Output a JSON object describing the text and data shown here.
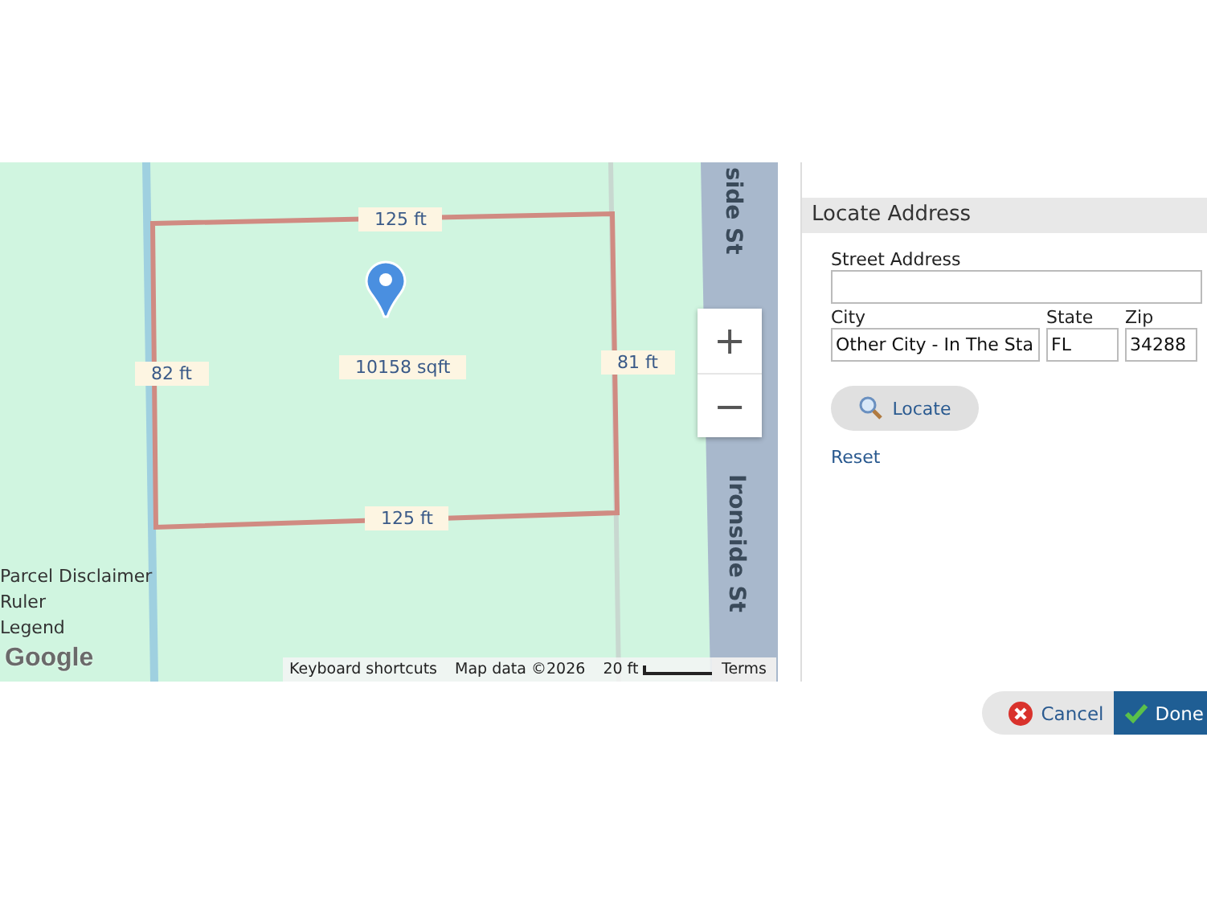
{
  "map": {
    "street_labels": [
      "side St",
      "Ironside St"
    ],
    "dimension_labels": [
      "125 ft",
      "82 ft",
      "10158 sqft",
      "81 ft",
      "125 ft"
    ],
    "zoom_controls": [
      "+",
      "−"
    ],
    "links": [
      "Parcel Disclaimer",
      "Ruler",
      "Legend"
    ],
    "logo": "Google",
    "footer": {
      "shortcuts": "Keyboard shortcuts",
      "map_data": "Map data ©2026",
      "scale": "20 ft",
      "terms": "Terms"
    }
  },
  "panel": {
    "title": "Locate Address",
    "fields": [
      {
        "label": "Street Address"
      },
      {
        "label": "City",
        "value": "Other City - In The Sta"
      },
      {
        "label": "State",
        "value": "FL"
      },
      {
        "label": "Zip",
        "value": "34288"
      }
    ],
    "locate_button": "Locate",
    "reset_link": "Reset"
  },
  "buttons": {
    "cancel": "Cancel",
    "done": "Done"
  }
}
